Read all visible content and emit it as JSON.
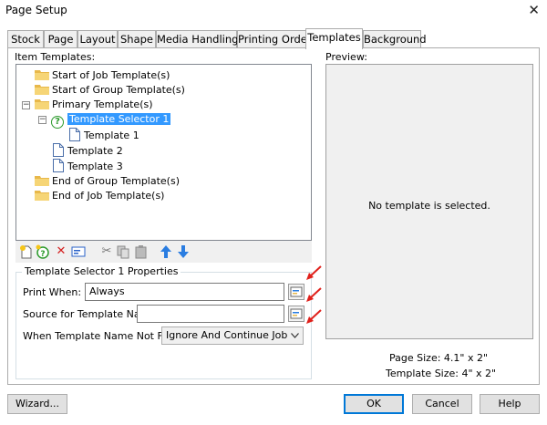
{
  "window": {
    "title": "Page Setup",
    "close_glyph": "✕"
  },
  "tabs": [
    {
      "label": "Stock"
    },
    {
      "label": "Page"
    },
    {
      "label": "Layout"
    },
    {
      "label": "Shape"
    },
    {
      "label": "Media Handling"
    },
    {
      "label": "Printing Order"
    },
    {
      "label": "Templates"
    },
    {
      "label": "Background"
    }
  ],
  "active_tab": "Templates",
  "item_templates": {
    "label": "Item Templates:",
    "nodes": [
      {
        "label": "Start of Job Template(s)",
        "icon": "folder-icon"
      },
      {
        "label": "Start of Group Template(s)",
        "icon": "folder-icon"
      },
      {
        "label": "Primary Template(s)",
        "icon": "folder-icon",
        "expanded": true
      },
      {
        "label": "Template Selector 1",
        "icon": "question-icon",
        "selected": true,
        "expanded": true
      },
      {
        "label": "Template 1",
        "icon": "document-icon"
      },
      {
        "label": "Template 2",
        "icon": "document-icon"
      },
      {
        "label": "Template 3",
        "icon": "document-icon"
      },
      {
        "label": "End of Group Template(s)",
        "icon": "folder-icon"
      },
      {
        "label": "End of Job Template(s)",
        "icon": "folder-icon"
      }
    ]
  },
  "toolbar_icons": [
    "new-template-icon",
    "new-selector-icon",
    "delete-icon",
    "properties-icon",
    "cut-icon",
    "copy-icon",
    "paste-icon",
    "move-up-icon",
    "move-down-icon"
  ],
  "properties": {
    "group_title": "Template Selector 1 Properties",
    "print_when_label": "Print When:",
    "print_when_value": "Always",
    "source_label": "Source for Template Name:",
    "source_value": "",
    "not_found_label": "When Template Name Not Found:",
    "not_found_value": "Ignore And Continue Job"
  },
  "preview": {
    "label": "Preview:",
    "message": "No template is selected.",
    "page_size": "Page Size:  4.1\" x 2\"",
    "template_size": "Template Size:  4\" x 2\""
  },
  "buttons": {
    "wizard": "Wizard...",
    "ok": "OK",
    "cancel": "Cancel",
    "help": "Help"
  },
  "colors": {
    "selection": "#3399ff",
    "annotation_arrow": "#e0201b",
    "default_button": "#0078d7"
  }
}
